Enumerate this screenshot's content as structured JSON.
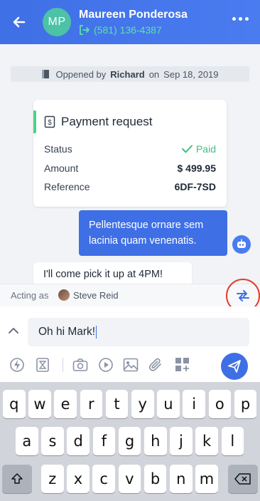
{
  "header": {
    "avatar_initials": "MP",
    "contact_name": "Maureen Ponderosa",
    "contact_phone": "(581) 136-4387",
    "colors": {
      "bar": "#3f6fe5",
      "avatar": "#4cc2a6",
      "phone": "#5de2a9"
    }
  },
  "conversation": {
    "opened_prefix": "Oppened by",
    "opened_by": "Richard",
    "opened_mid": "on",
    "opened_date": "Sep 18, 2019",
    "payment": {
      "title": "Payment request",
      "rows": [
        {
          "label": "Status",
          "value": "Paid"
        },
        {
          "label": "Amount",
          "value": "$ 499.95"
        },
        {
          "label": "Reference",
          "value": "6DF-7SD"
        }
      ]
    },
    "outgoing_message": "Pellentesque ornare sem lacinia quam venenatis.",
    "incoming_message": "I'll come pick it up at 4PM!"
  },
  "acting": {
    "label": "Acting as",
    "name": "Steve Reid"
  },
  "composer": {
    "input_value": "Oh hi Mark!",
    "tools": [
      "lightning-icon",
      "template-icon",
      "camera-icon",
      "video-icon",
      "image-icon",
      "attachment-icon",
      "apps-icon"
    ],
    "send_color": "#3f6fe5"
  },
  "keyboard": {
    "row1": [
      "q",
      "w",
      "e",
      "r",
      "t",
      "y",
      "u",
      "i",
      "o",
      "p"
    ],
    "row2": [
      "a",
      "s",
      "d",
      "f",
      "g",
      "h",
      "j",
      "k",
      "l"
    ],
    "row3": [
      "z",
      "x",
      "c",
      "v",
      "b",
      "n",
      "m"
    ]
  }
}
